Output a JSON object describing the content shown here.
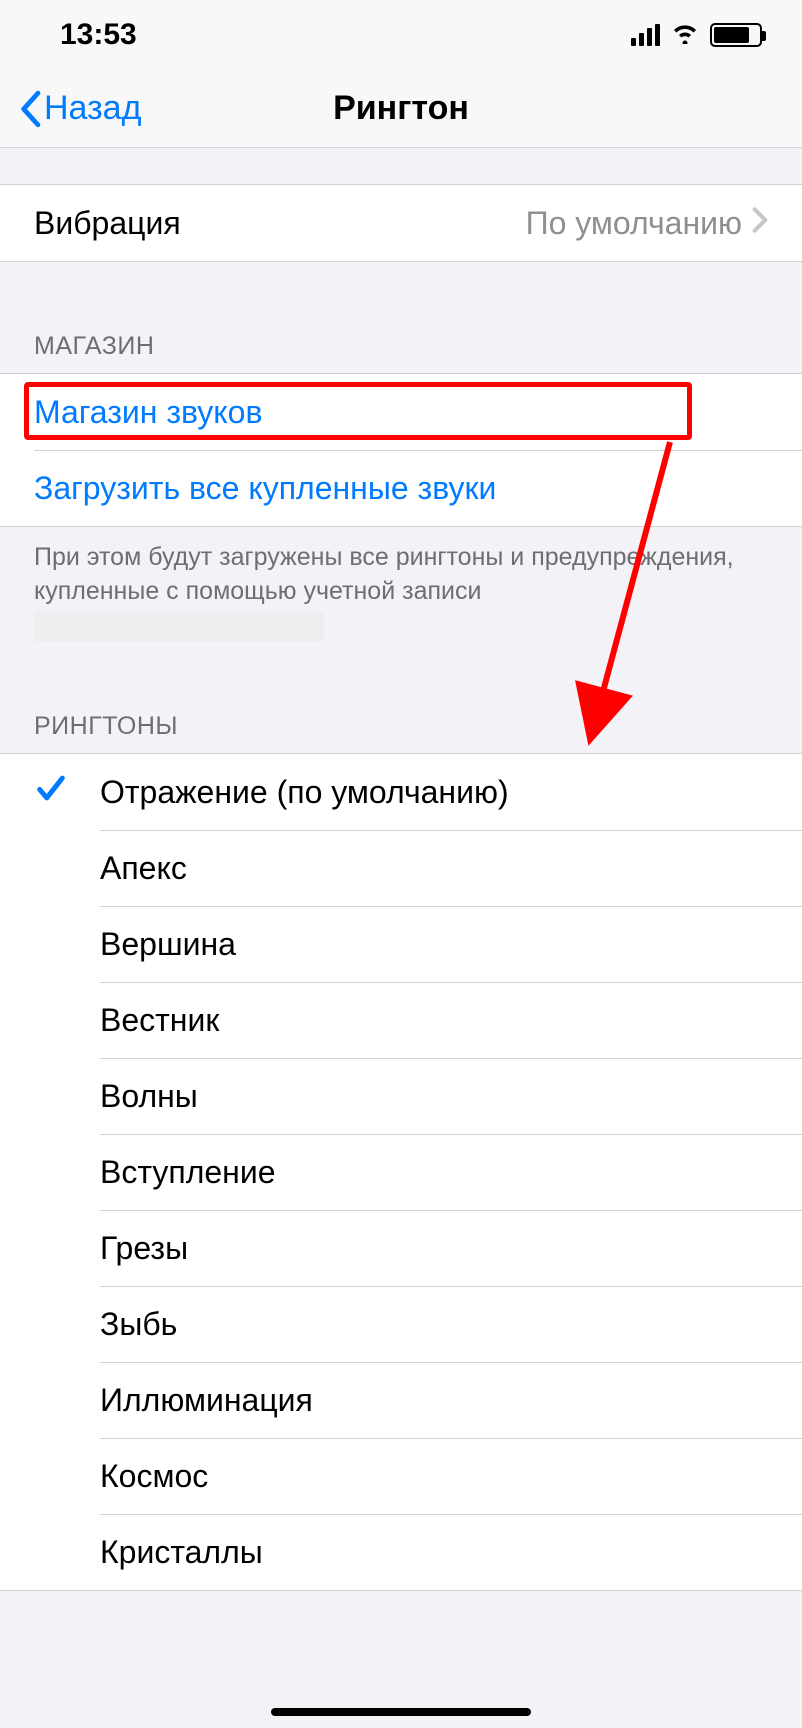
{
  "status": {
    "time": "13:53"
  },
  "nav": {
    "back": "Назад",
    "title": "Рингтон"
  },
  "vibration": {
    "label": "Вибрация",
    "value": "По умолчанию"
  },
  "store": {
    "header": "МАГАЗИН",
    "sound_store": "Магазин звуков",
    "download_all": "Загрузить все купленные звуки",
    "footer": "При этом будут загружены все рингтоны и предупреждения, купленные с помощью учетной записи"
  },
  "ringtones": {
    "header": "РИНГТОНЫ",
    "items": [
      {
        "label": "Отражение (по умолчанию)",
        "selected": true
      },
      {
        "label": "Апекс",
        "selected": false
      },
      {
        "label": "Вершина",
        "selected": false
      },
      {
        "label": "Вестник",
        "selected": false
      },
      {
        "label": "Волны",
        "selected": false
      },
      {
        "label": "Вступление",
        "selected": false
      },
      {
        "label": "Грезы",
        "selected": false
      },
      {
        "label": "Зыбь",
        "selected": false
      },
      {
        "label": "Иллюминация",
        "selected": false
      },
      {
        "label": "Космос",
        "selected": false
      },
      {
        "label": "Кристаллы",
        "selected": false
      }
    ]
  },
  "annotations": {
    "highlight_target": "sound-store-row",
    "arrow": {
      "from": "sound-store-row",
      "to": "ringtone-list"
    }
  }
}
